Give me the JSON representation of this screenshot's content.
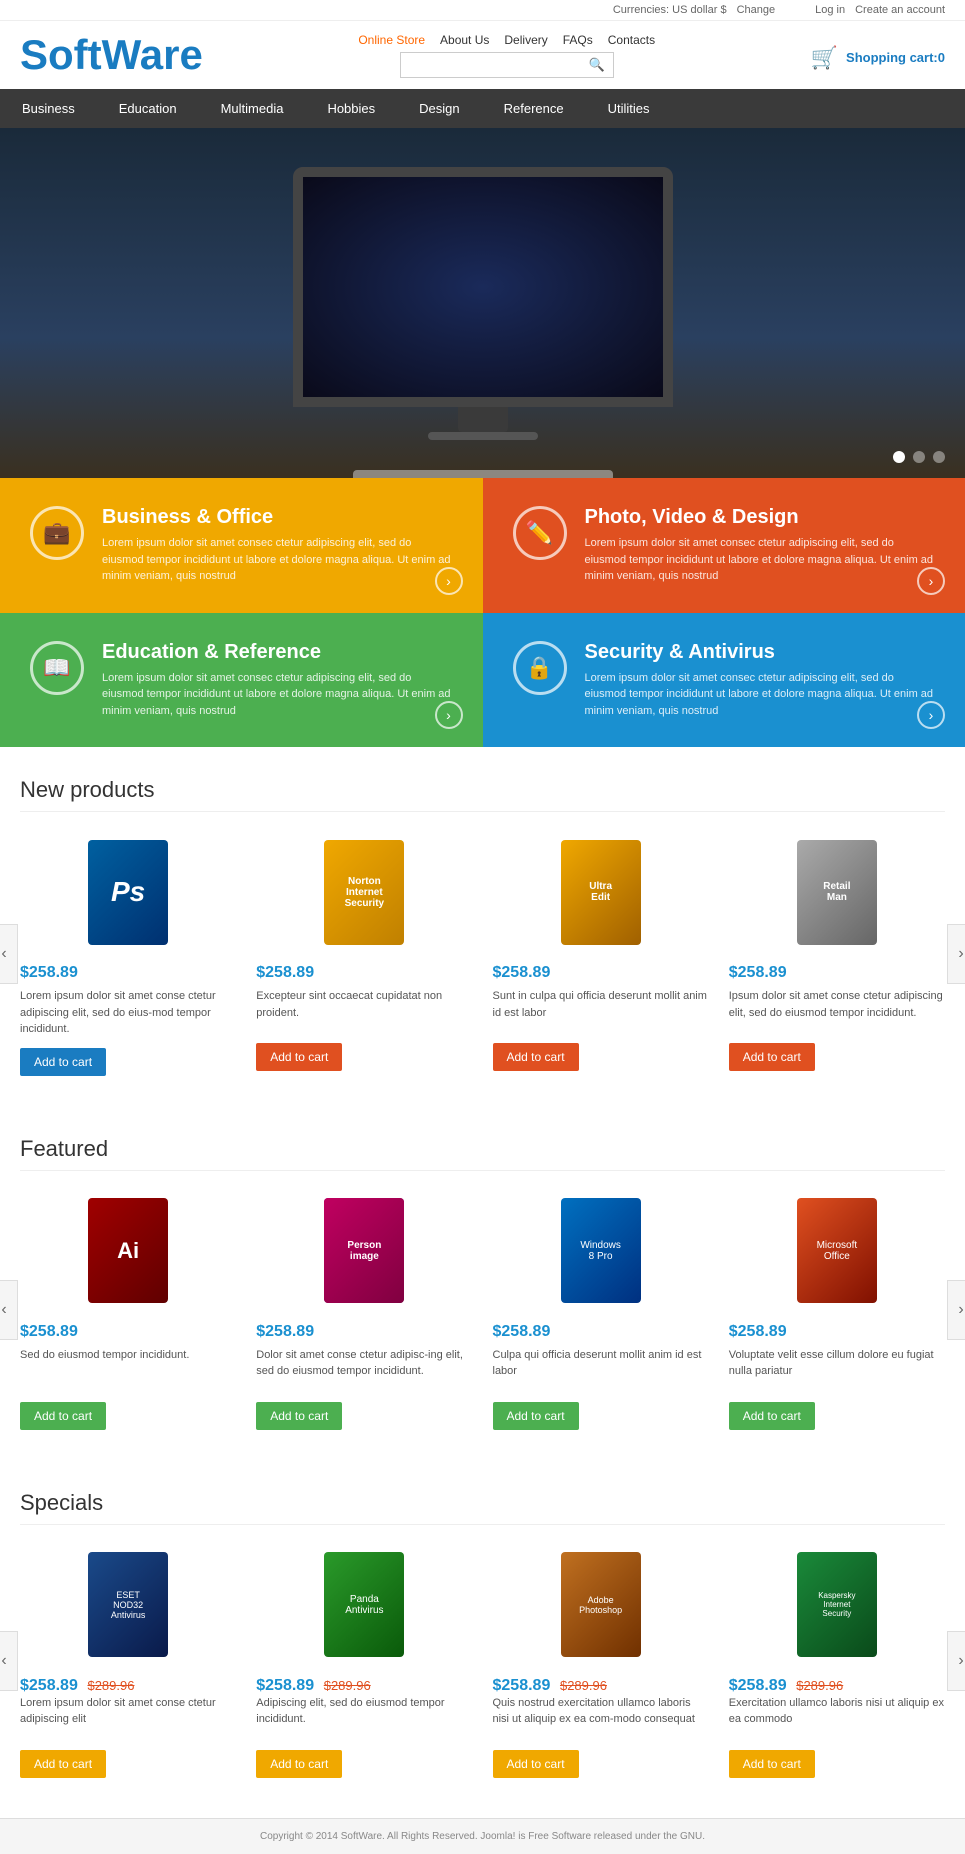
{
  "topbar": {
    "currency_label": "Currencies: US dollar $",
    "change_label": "Change",
    "login_label": "Log in",
    "create_account_label": "Create an account"
  },
  "header": {
    "logo_soft": "Soft",
    "logo_ware": "Ware",
    "nav_links": [
      {
        "label": "Online Store",
        "active": true
      },
      {
        "label": "About Us"
      },
      {
        "label": "Delivery"
      },
      {
        "label": "FAQs"
      },
      {
        "label": "Contacts"
      }
    ],
    "search_placeholder": "",
    "cart_label": "Shopping cart:",
    "cart_count": "0"
  },
  "main_nav": [
    {
      "label": "Business"
    },
    {
      "label": "Education"
    },
    {
      "label": "Multimedia"
    },
    {
      "label": "Hobbies"
    },
    {
      "label": "Design"
    },
    {
      "label": "Reference"
    },
    {
      "label": "Utilities"
    }
  ],
  "categories": [
    {
      "title": "Business & Office",
      "desc": "Lorem ipsum dolor sit amet consec ctetur adipiscing elit, sed do eiusmod tempor incididunt ut labore et dolore magna aliqua. Ut enim ad minim veniam, quis nostrud",
      "color": "yellow",
      "icon": "💼"
    },
    {
      "title": "Photo, Video & Design",
      "desc": "Lorem ipsum dolor sit amet consec ctetur adipiscing elit, sed do eiusmod tempor incididunt ut labore et dolore magna aliqua. Ut enim ad minim veniam, quis nostrud",
      "color": "orange",
      "icon": "✏️"
    },
    {
      "title": "Education & Reference",
      "desc": "Lorem ipsum dolor sit amet consec ctetur adipiscing elit, sed do eiusmod tempor incididunt ut labore et dolore magna aliqua. Ut enim ad minim veniam, quis nostrud",
      "color": "green",
      "icon": "📖"
    },
    {
      "title": "Security & Antivirus",
      "desc": "Lorem ipsum dolor sit amet consec ctetur adipiscing elit, sed do eiusmod tempor incididunt ut labore et dolore magna aliqua. Ut enim ad minim veniam, quis nostrud",
      "color": "blue",
      "icon": "🔒"
    }
  ],
  "new_products": {
    "section_title": "New products",
    "items": [
      {
        "box_type": "ps",
        "price": "$258.89",
        "desc": "Lorem ipsum dolor sit amet conse ctetur adipiscing elit, sed do eius-mod tempor incididunt.",
        "btn_label": "Add to cart",
        "btn_color": "blue"
      },
      {
        "box_type": "norton",
        "price": "$258.89",
        "desc": "Excepteur sint occaecat cupidatat non proident.",
        "btn_label": "Add to cart",
        "btn_color": "orange"
      },
      {
        "box_type": "ultraedit",
        "price": "$258.89",
        "desc": "Sunt in culpa qui officia deserunt mollit anim id est labor",
        "btn_label": "Add to cart",
        "btn_color": "orange"
      },
      {
        "box_type": "retailman",
        "price": "$258.89",
        "desc": "Ipsum dolor sit amet conse ctetur adipiscing elit, sed do eiusmod tempor incididunt.",
        "btn_label": "Add to cart",
        "btn_color": "orange"
      }
    ]
  },
  "featured": {
    "section_title": "Featured",
    "items": [
      {
        "box_type": "adobe2",
        "price": "$258.89",
        "desc": "Sed do eiusmod tempor incididunt.",
        "btn_label": "Add to cart",
        "btn_color": "green"
      },
      {
        "box_type": "adobe3",
        "price": "$258.89",
        "desc": "Dolor sit amet conse ctetur adipisc-ing elit, sed do eiusmod tempor incididunt.",
        "btn_label": "Add to cart",
        "btn_color": "green"
      },
      {
        "box_type": "win8",
        "price": "$258.89",
        "desc": "Culpa qui officia deserunt mollit anim id est labor",
        "btn_label": "Add to cart",
        "btn_color": "green"
      },
      {
        "box_type": "office",
        "price": "$258.89",
        "desc": "Voluptate velit esse cillum dolore eu fugiat nulla pariatur",
        "btn_label": "Add to cart",
        "btn_color": "green"
      }
    ]
  },
  "specials": {
    "section_title": "Specials",
    "items": [
      {
        "box_type": "nod32",
        "price": "$258.89",
        "price_old": "$289.96",
        "desc": "Lorem ipsum dolor sit amet conse ctetur adipiscing elit",
        "btn_label": "Add to cart",
        "btn_color": "yellow"
      },
      {
        "box_type": "panda",
        "price": "$258.89",
        "price_old": "$289.96",
        "desc": "Adipiscing elit, sed do eiusmod tempor incididunt.",
        "btn_label": "Add to cart",
        "btn_color": "yellow"
      },
      {
        "box_type": "adobe4",
        "price": "$258.89",
        "price_old": "$289.96",
        "desc": "Quis nostrud exercitation ullamco laboris nisi ut aliquip ex ea com-modo consequat",
        "btn_label": "Add to cart",
        "btn_color": "yellow"
      },
      {
        "box_type": "kaspersky",
        "price": "$258.89",
        "price_old": "$289.96",
        "desc": "Exercitation ullamco laboris nisi ut aliquip ex ea commodo",
        "btn_label": "Add to cart",
        "btn_color": "yellow"
      }
    ]
  },
  "footer": {
    "text": "Copyright © 2014 SoftWare. All Rights Reserved. Joomla! is Free Software released under the GNU."
  }
}
